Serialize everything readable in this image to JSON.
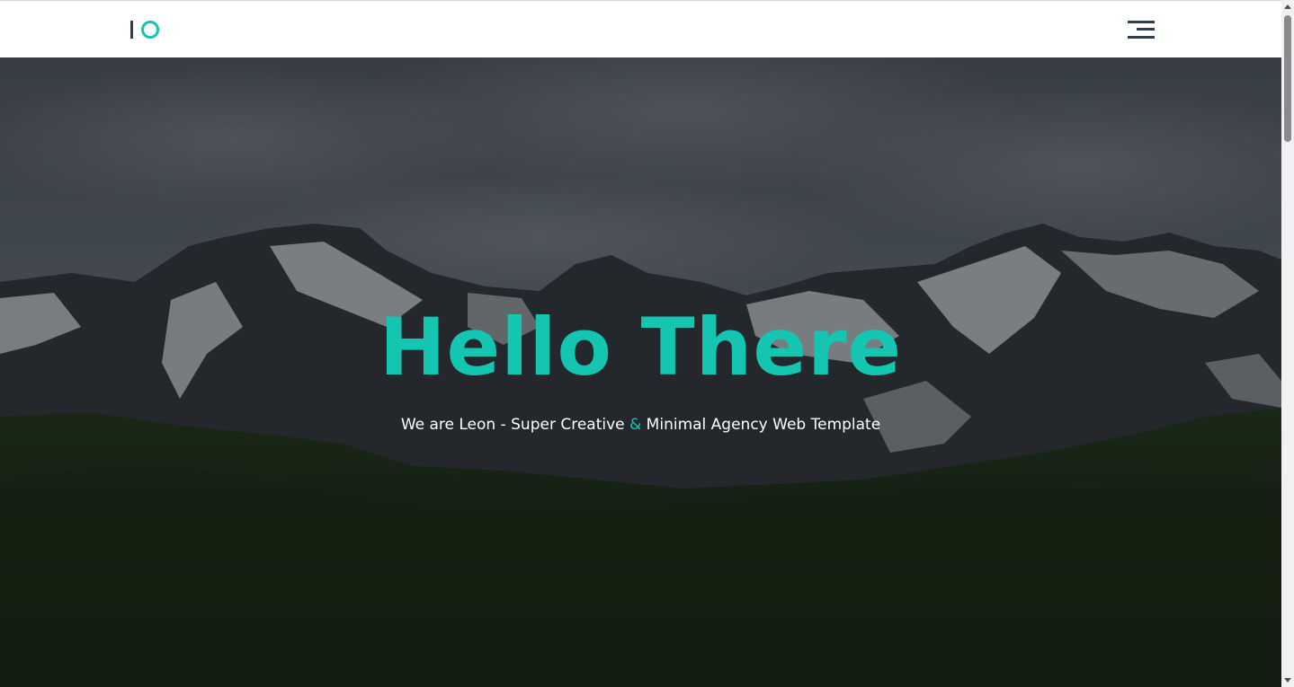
{
  "header": {
    "logo_label": "IO",
    "menu_icon": "hamburger-menu-icon"
  },
  "hero": {
    "title": "Hello There",
    "subtitle_before": "We are Leon - Super Creative ",
    "subtitle_amp": "&",
    "subtitle_after": " Minimal Agency Web Template"
  },
  "colors": {
    "accent": "#14c5b2",
    "dark": "#2c3e50",
    "subtitle": "#ffffff",
    "header_bg": "#ffffff"
  }
}
